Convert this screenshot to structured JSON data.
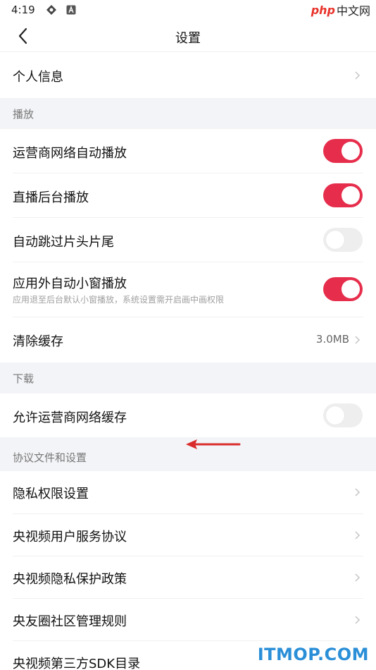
{
  "status_bar": {
    "time": "4:19"
  },
  "watermark_top": {
    "brand": "php",
    "cn": "中文网"
  },
  "nav": {
    "title": "设置"
  },
  "rows": {
    "profile": "个人信息",
    "carrier_autoplay": "运营商网络自动播放",
    "live_bg": "直播后台播放",
    "skip_intro": "自动跳过片头片尾",
    "pip": "应用外自动小窗播放",
    "pip_sub": "应用退至后台默认小窗播放，系统设置需开启画中画权限",
    "clear_cache": "清除缓存",
    "cache_size": "3.0MB",
    "allow_carrier_cache": "允许运营商网络缓存",
    "privacy_perm": "隐私权限设置",
    "user_agreement": "央视频用户服务协议",
    "privacy_policy": "央视频隐私保护政策",
    "community_rules": "央友圈社区管理规则",
    "sdk_list": "央视频第三方SDK目录"
  },
  "sections": {
    "playback": "播放",
    "download": "下载",
    "agreements": "协议文件和设置"
  },
  "toggles": {
    "carrier_autoplay": true,
    "live_bg": true,
    "skip_intro": false,
    "pip": true,
    "allow_carrier_cache": false
  },
  "colors": {
    "toggle_on": "#e62e4c",
    "toggle_off": "#eeeeee",
    "section_bg": "#f3f4f7",
    "annotation_arrow": "#d92b2b",
    "watermark_bottom": "#2b8fd8"
  },
  "watermark_bottom": {
    "text": "ITMOP.COM"
  }
}
